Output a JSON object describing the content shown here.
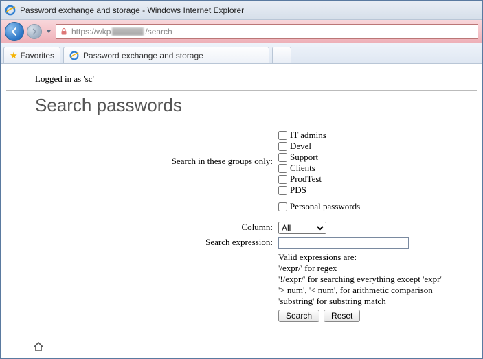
{
  "window": {
    "title": "Password exchange and storage - Windows Internet Explorer"
  },
  "address": {
    "scheme": "https://",
    "host_prefix": "wkp",
    "path": "/search"
  },
  "favorites_label": "Favorites",
  "tab": {
    "title": "Password exchange and storage"
  },
  "page": {
    "logged_in_text": "Logged in as 'sc'",
    "heading": "Search passwords",
    "groups_label": "Search in these groups only:",
    "groups": [
      {
        "label": "IT admins"
      },
      {
        "label": "Devel"
      },
      {
        "label": "Support"
      },
      {
        "label": "Clients"
      },
      {
        "label": "ProdTest"
      },
      {
        "label": "PDS"
      }
    ],
    "personal_label": "Personal passwords",
    "column_label": "Column:",
    "column_value": "All",
    "expr_label": "Search expression:",
    "expr_value": "",
    "hints": [
      "Valid expressions are:",
      "'/expr/' for regex",
      "'!/expr/' for searching everything except 'expr'",
      "'> num', '< num', for arithmetic comparison",
      "'substring' for substring match"
    ],
    "search_btn": "Search",
    "reset_btn": "Reset"
  }
}
